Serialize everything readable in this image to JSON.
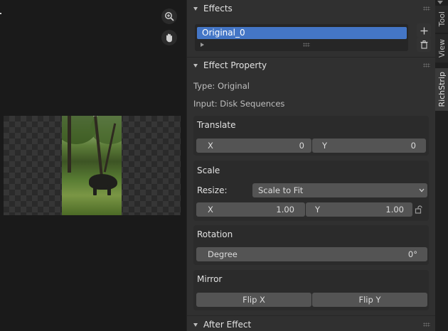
{
  "preview": {
    "zoom_icon": "zoom-icon",
    "pan_icon": "hand-icon"
  },
  "effects": {
    "header": "Effects",
    "items": [
      "Original_0"
    ],
    "add_icon": "plus-icon",
    "remove_icon": "trash-icon"
  },
  "effect_property": {
    "header": "Effect Property",
    "type_line": "Type: Original",
    "input_line": "Input: Disk Sequences",
    "translate": {
      "title": "Translate",
      "x_label": "X",
      "x_value": "0",
      "y_label": "Y",
      "y_value": "0"
    },
    "scale": {
      "title": "Scale",
      "resize_label": "Resize:",
      "resize_value": "Scale to Fit",
      "x_label": "X",
      "x_value": "1.00",
      "y_label": "Y",
      "y_value": "1.00"
    },
    "rotation": {
      "title": "Rotation",
      "degree_label": "Degree",
      "degree_value": "0°"
    },
    "mirror": {
      "title": "Mirror",
      "flip_x": "Flip X",
      "flip_y": "Flip Y"
    }
  },
  "after_effect": {
    "header": "After Effect"
  },
  "tabs": [
    "Tool",
    "View",
    "RichStrip"
  ],
  "active_tab": "RichStrip",
  "colors": {
    "selection": "#4476c6",
    "panel": "#303030",
    "field": "#545454"
  }
}
